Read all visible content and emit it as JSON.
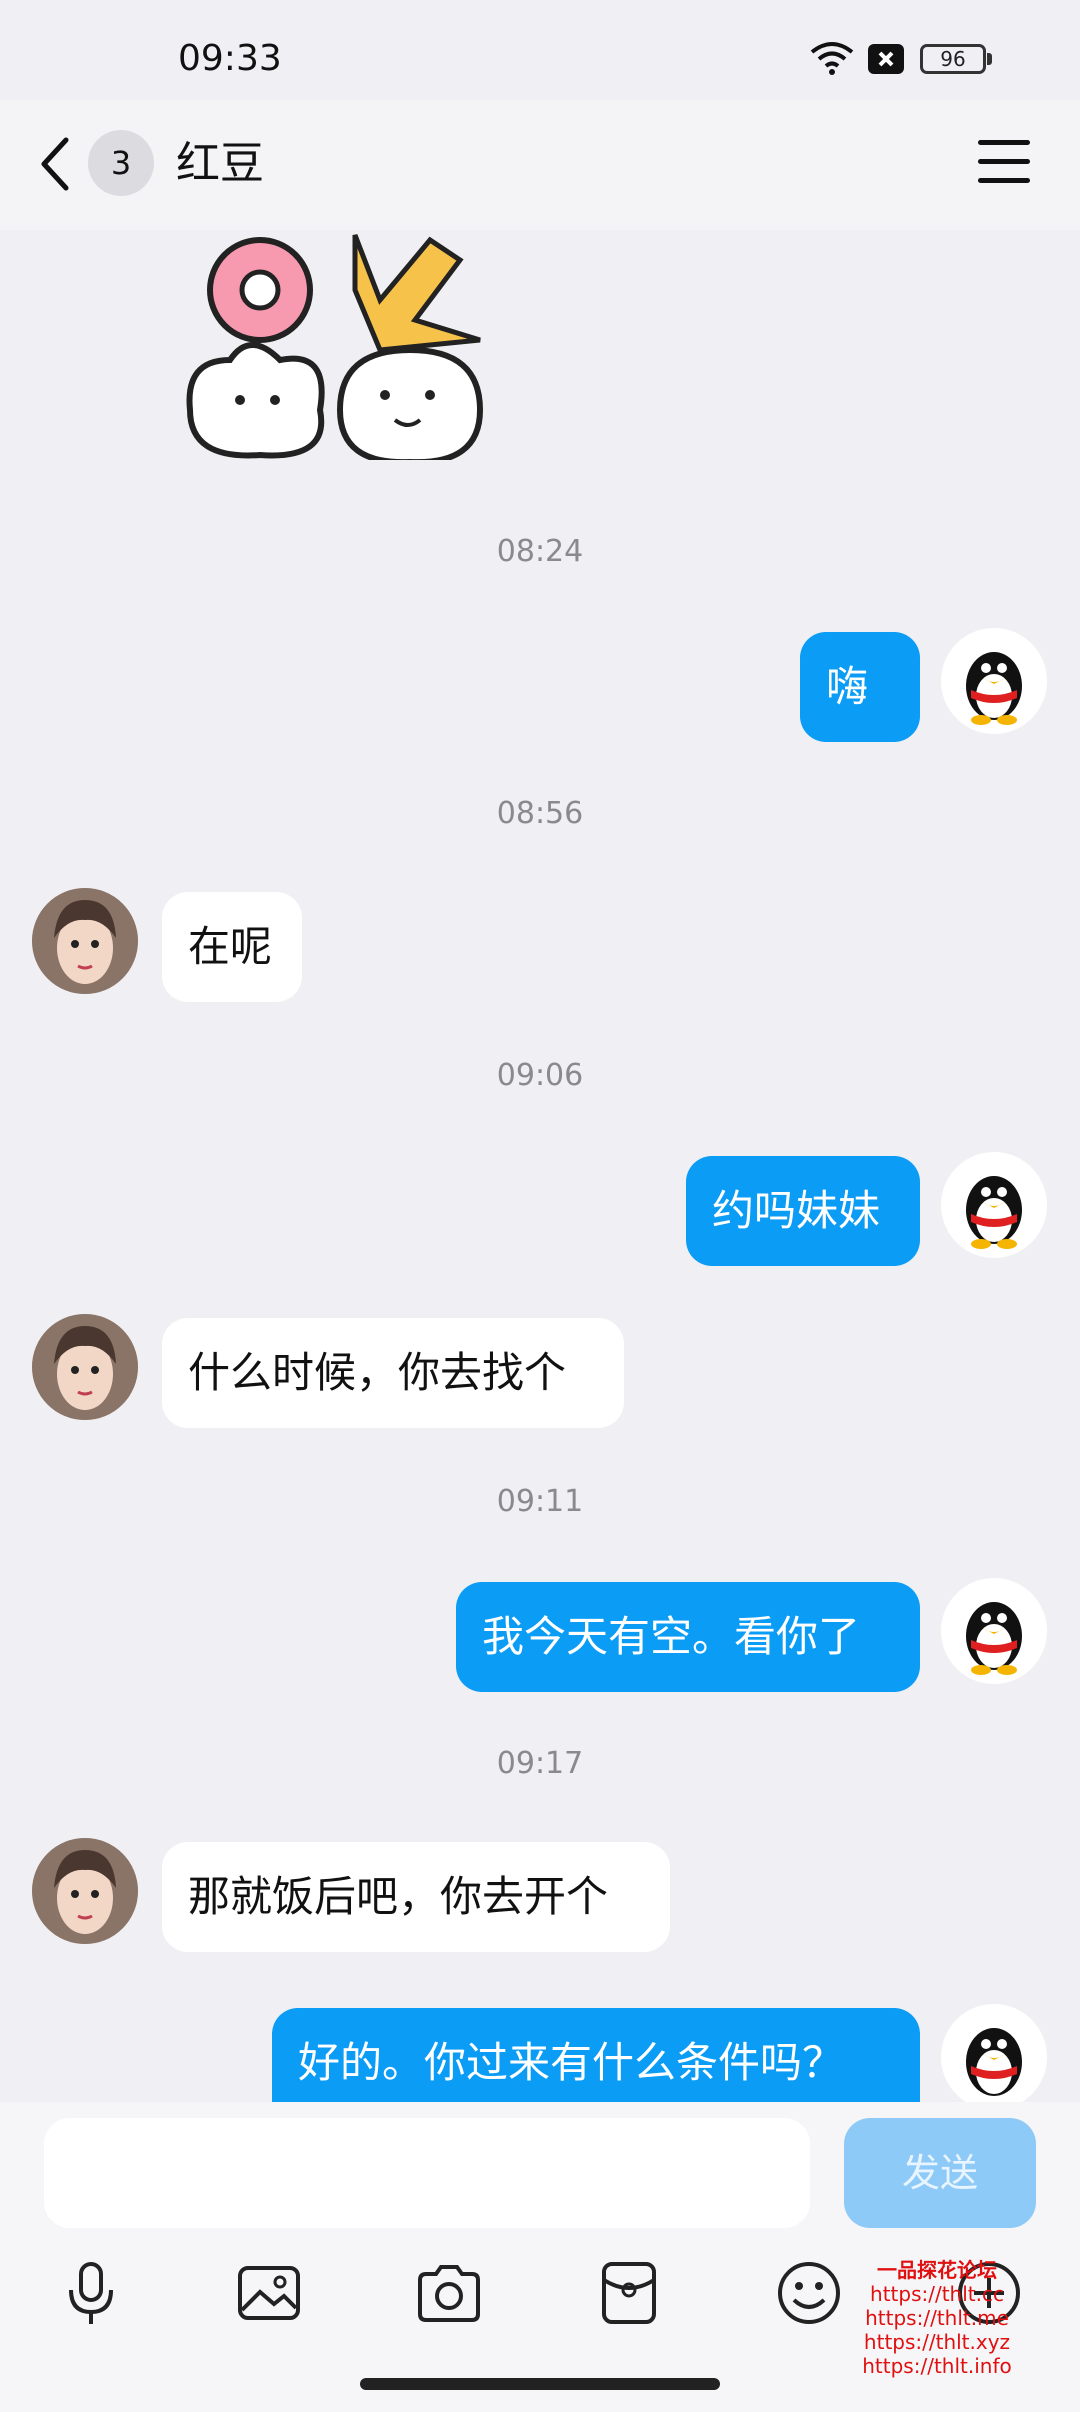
{
  "status_bar": {
    "time": "09:33",
    "battery": "96"
  },
  "header": {
    "unread_count": "3",
    "title": "红豆"
  },
  "messages": [
    {
      "kind": "time",
      "text": "08:24"
    },
    {
      "kind": "out",
      "text": "嗨"
    },
    {
      "kind": "time",
      "text": "08:56"
    },
    {
      "kind": "in",
      "text": "在呢"
    },
    {
      "kind": "time",
      "text": "09:06"
    },
    {
      "kind": "out",
      "text": "约吗妹妹"
    },
    {
      "kind": "in",
      "text": "什么时候，你去找个"
    },
    {
      "kind": "time",
      "text": "09:11"
    },
    {
      "kind": "out",
      "text": "我今天有空。看你了"
    },
    {
      "kind": "time",
      "text": "09:17"
    },
    {
      "kind": "in",
      "text": "那就饭后吧，你去开个"
    },
    {
      "kind": "out",
      "text": "好的。你过来有什么条件吗？"
    }
  ],
  "composer": {
    "input_value": "",
    "send_label": "发送"
  },
  "toolbar_icons": [
    "microphone-icon",
    "image-icon",
    "camera-icon",
    "red-packet-icon",
    "emoji-icon",
    "plus-icon"
  ],
  "watermark": {
    "line1": "一品探花论坛",
    "line2": "https://thlt.cc",
    "line3": "https://thlt.me",
    "line4": "https://thlt.xyz",
    "line5": "https://thlt.info"
  },
  "colors": {
    "outgoing_bubble": "#0b9cf5",
    "incoming_bubble": "#ffffff",
    "send_button": "#8ecaf7",
    "background": "#f0f0f4"
  }
}
